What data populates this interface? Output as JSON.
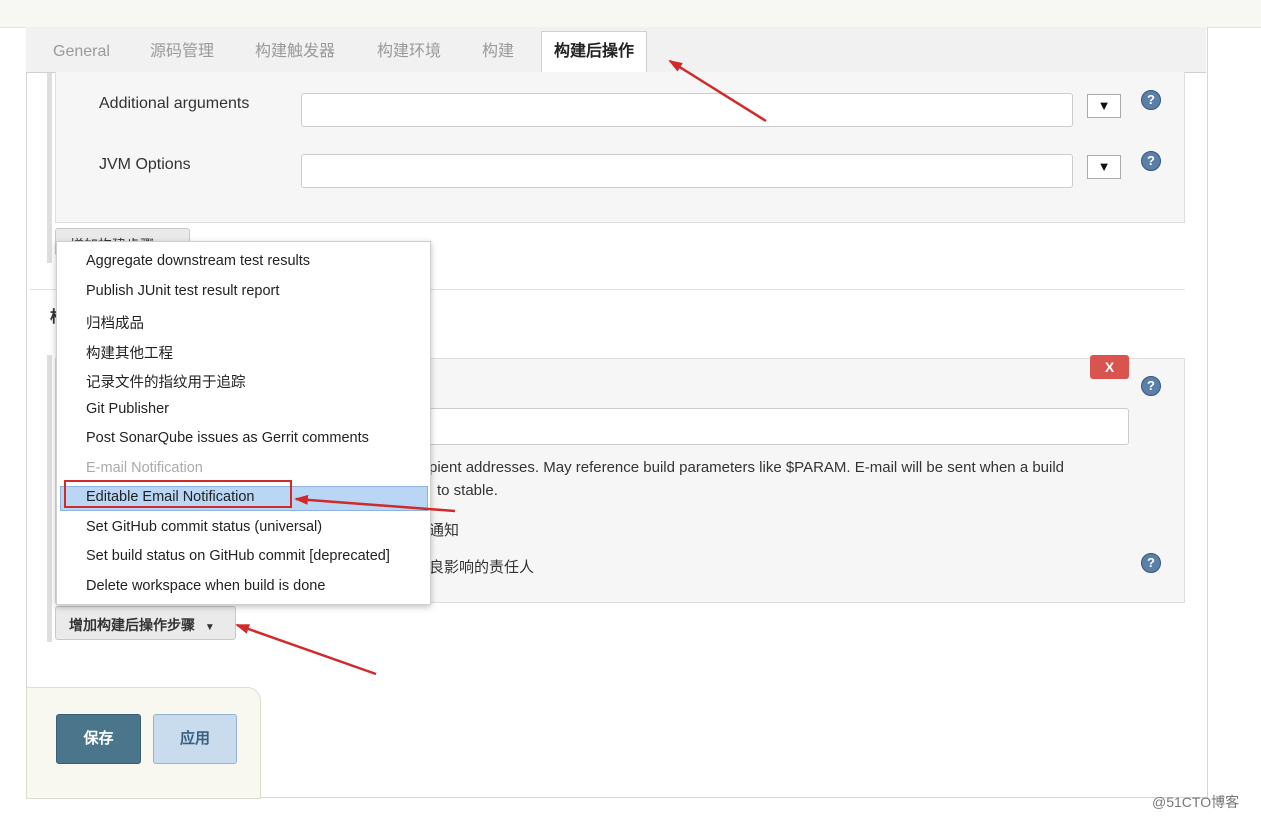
{
  "tabs": [
    {
      "label": "General"
    },
    {
      "label": "源码管理"
    },
    {
      "label": "构建触发器"
    },
    {
      "label": "构建环境"
    },
    {
      "label": "构建"
    },
    {
      "label": "构建后操作"
    }
  ],
  "fields": {
    "additional_arguments": {
      "label": "Additional arguments",
      "value": ""
    },
    "jvm_options": {
      "label": "JVM Options",
      "value": ""
    }
  },
  "icons": {
    "dropdown": "▼",
    "help": "?"
  },
  "add_build_step_label": "增加构建步骤",
  "section_label_fragment": "构",
  "email": {
    "remove_label": "X",
    "recipients_value": "",
    "description_line1": "pient addresses. May reference build parameters like $PARAM. E-mail will be sent when a build",
    "description_line2": "to stable.",
    "option1_text": "通知",
    "option2_text": "良影响的责任人"
  },
  "menu": {
    "items": [
      {
        "label": "Aggregate downstream test results",
        "disabled": false
      },
      {
        "label": "Publish JUnit test result report",
        "disabled": false
      },
      {
        "label": "归档成品",
        "disabled": false
      },
      {
        "label": "构建其他工程",
        "disabled": false
      },
      {
        "label": "记录文件的指纹用于追踪",
        "disabled": false
      },
      {
        "label": "Git Publisher",
        "disabled": false
      },
      {
        "label": "Post SonarQube issues as Gerrit comments",
        "disabled": false
      },
      {
        "label": "E-mail Notification",
        "disabled": true
      },
      {
        "label": "Editable Email Notification",
        "disabled": false,
        "highlighted": true
      },
      {
        "label": "Set GitHub commit status (universal)",
        "disabled": false
      },
      {
        "label": "Set build status on GitHub commit [deprecated]",
        "disabled": false
      },
      {
        "label": "Delete workspace when build is done",
        "disabled": false
      }
    ]
  },
  "add_post_build_label": "增加构建后操作步骤",
  "buttons": {
    "save": "保存",
    "apply": "应用"
  },
  "watermark": "@51CTO博客",
  "colors": {
    "annotation_red": "#d02a2a",
    "save_bg": "#4b758b",
    "apply_bg": "#c8dcee",
    "highlight": "#b9d6f5",
    "remove_red": "#d9534f"
  }
}
